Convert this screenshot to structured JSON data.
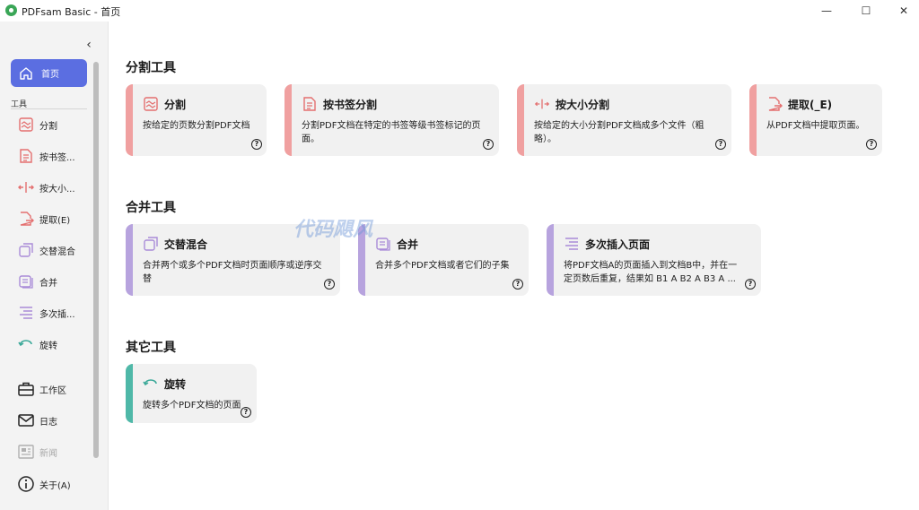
{
  "window": {
    "title": "PDFsam Basic - 首页",
    "controls": {
      "minimize": "—",
      "maximize": "☐",
      "close": "✕"
    }
  },
  "colors": {
    "accent": "#5b6ee1",
    "split_accent": "#f0a0a0",
    "merge_accent": "#b7a3de",
    "other_accent": "#4fb8a8"
  },
  "sidebar": {
    "collapse_glyph": "‹",
    "home": {
      "label": "首页",
      "icon": "home-icon"
    },
    "section_label": "工具",
    "tools": [
      {
        "label": "分割",
        "icon": "split-icon"
      },
      {
        "label": "按书签...",
        "icon": "bookmark-split-icon"
      },
      {
        "label": "按大小...",
        "icon": "size-split-icon"
      },
      {
        "label": "提取(E)",
        "icon": "extract-icon"
      },
      {
        "label": "交替混合",
        "icon": "alternate-mix-icon"
      },
      {
        "label": "合并",
        "icon": "merge-icon"
      },
      {
        "label": "多次插...",
        "icon": "insert-icon"
      },
      {
        "label": "旋转",
        "icon": "rotate-icon"
      }
    ],
    "bottom": [
      {
        "label": "工作区",
        "icon": "briefcase-icon"
      },
      {
        "label": "日志",
        "icon": "log-icon"
      },
      {
        "label": "新闻",
        "icon": "news-icon"
      },
      {
        "label": "关于(A)",
        "icon": "info-icon"
      }
    ]
  },
  "main": {
    "sections": [
      {
        "title": "分割工具",
        "cards": [
          {
            "title": "分割",
            "desc": "按给定的页数分割PDF文档",
            "icon": "split-icon"
          },
          {
            "title": "按书签分割",
            "desc": "分割PDF文档在特定的书签等级书签标记的页面。",
            "icon": "bookmark-split-icon"
          },
          {
            "title": "按大小分割",
            "desc": "按给定的大小分割PDF文档成多个文件（粗略）。",
            "icon": "size-split-icon"
          },
          {
            "title": "提取(_E)",
            "desc": "从PDF文档中提取页面。",
            "icon": "extract-icon"
          }
        ]
      },
      {
        "title": "合并工具",
        "cards": [
          {
            "title": "交替混合",
            "desc": "合并两个或多个PDF文档时页面顺序或逆序交替",
            "icon": "alternate-mix-icon"
          },
          {
            "title": "合并",
            "desc": "合并多个PDF文档或者它们的子集",
            "icon": "merge-icon"
          },
          {
            "title": "多次插入页面",
            "desc": "将PDF文档A的页面插入到文档B中，并在一定页数后重复，结果如 B1 A B2 A B3 A ...",
            "icon": "insert-icon"
          }
        ]
      },
      {
        "title": "其它工具",
        "cards": [
          {
            "title": "旋转",
            "desc": "旋转多个PDF文档的页面",
            "icon": "rotate-icon"
          }
        ]
      }
    ],
    "help_glyph": "?"
  },
  "watermark": "代码飓风"
}
